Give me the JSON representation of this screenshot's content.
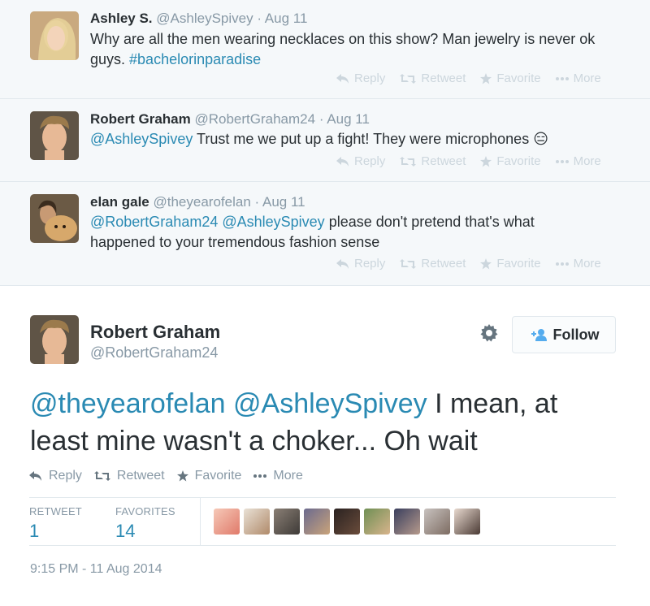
{
  "replies": [
    {
      "fullname": "Ashley S.",
      "username": "@AshleySpivey",
      "dot": "·",
      "time": "Aug 11",
      "text_line1_a": "Why are all the men wearing necklaces on this show? Man jewelry is never ok",
      "text_line2_a": "guys. ",
      "text_line2_link": "#bachelorinparadise"
    },
    {
      "fullname": "Robert Graham",
      "username": "@RobertGraham24",
      "dot": "·",
      "time": "Aug 11",
      "text_link": "@AshleySpivey",
      "text_rest": " Trust me we put up a fight! They were microphones ",
      "emoji": "😑"
    },
    {
      "fullname": "elan gale",
      "username": "@theyearofelan",
      "dot": "·",
      "time": "Aug 11",
      "text_link1": "@RobertGraham24",
      "text_link2": "@AshleySpivey",
      "text_rest_line1": " please don't pretend that's what",
      "text_line2": "happened to your tremendous fashion sense"
    }
  ],
  "reply_actions": {
    "reply": "Reply",
    "retweet": "Retweet",
    "favorite": "Favorite",
    "more": "More"
  },
  "main": {
    "fullname": "Robert Graham",
    "username": "@RobertGraham24",
    "follow_label": "Follow",
    "text_link1": "@theyearofelan",
    "text_link2": "@AshleySpivey",
    "text_rest_line1": " I mean, at",
    "text_line2": "least mine wasn't a choker... Oh wait",
    "actions": {
      "reply": "Reply",
      "retweet": "Retweet",
      "favorite": "Favorite",
      "more": "More"
    },
    "stats": {
      "retweet_label": "RETWEET",
      "retweet_count": "1",
      "favorites_label": "FAVORITES",
      "favorites_count": "14"
    },
    "timestamp": "9:15 PM - 11 Aug 2014"
  },
  "colors": {
    "link": "#2a8ab3",
    "reply_bg": "#f5f8fa",
    "muted": "#8899a6",
    "action_faded": "#ccd6dd"
  },
  "icons": [
    "reply-icon",
    "retweet-icon",
    "star-icon",
    "more-dots-icon",
    "gear-icon",
    "follow-person-icon"
  ]
}
